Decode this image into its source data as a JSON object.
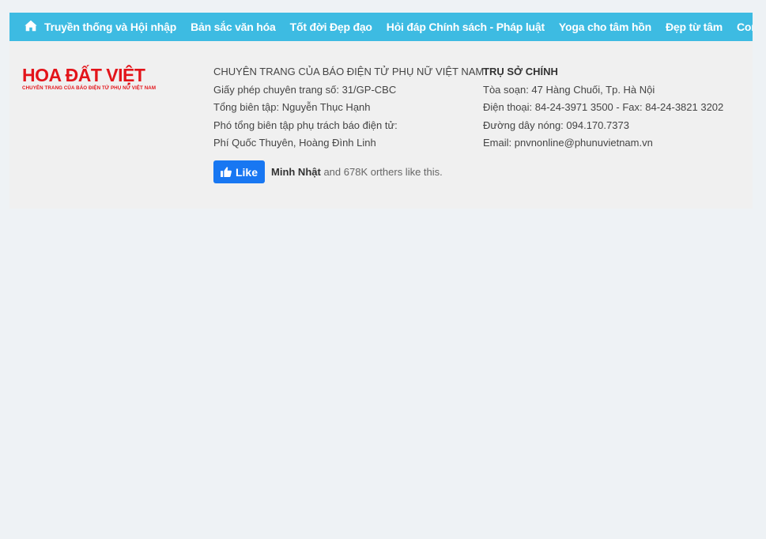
{
  "nav": {
    "items": [
      "Truyền thống và Hội nhập",
      "Bản sắc văn hóa",
      "Tốt đời Đẹp đạo",
      "Hỏi đáp Chính sách - Pháp luật",
      "Yoga cho tâm hồn",
      "Đẹp từ tâm",
      "Con"
    ]
  },
  "logo": {
    "title": "HOA ĐẤT VIỆT",
    "subtitle": "CHUYÊN TRANG CỦA BÁO ĐIỆN TỬ PHỤ NỮ VIỆT NAM"
  },
  "info": {
    "lines": [
      "CHUYÊN TRANG CỦA BÁO ĐIỆN TỬ PHỤ NỮ VIỆT NAM",
      "Giấy phép chuyên trang số: 31/GP-CBC",
      "Tổng biên tập: Nguyễn Thục Hạnh",
      "Phó tổng biên tập phụ trách báo điện tử:",
      "Phí Quốc Thuyên, Hoàng Đình Linh"
    ]
  },
  "office": {
    "heading": "TRỤ SỞ CHÍNH",
    "address": "Tòa soạn: 47 Hàng Chuối, Tp. Hà Nội",
    "phone": "Điện thoại: 84-24-3971 3500 - Fax: 84-24-3821 3202",
    "hotline": "Đường dây nóng: 094.170.7373",
    "email": "Email: pnvnonline@phunuvietnam.vn"
  },
  "facebook": {
    "like_label": "Like",
    "friend_name": "Minh Nhật",
    "like_text": "and 678K orthers like this."
  }
}
